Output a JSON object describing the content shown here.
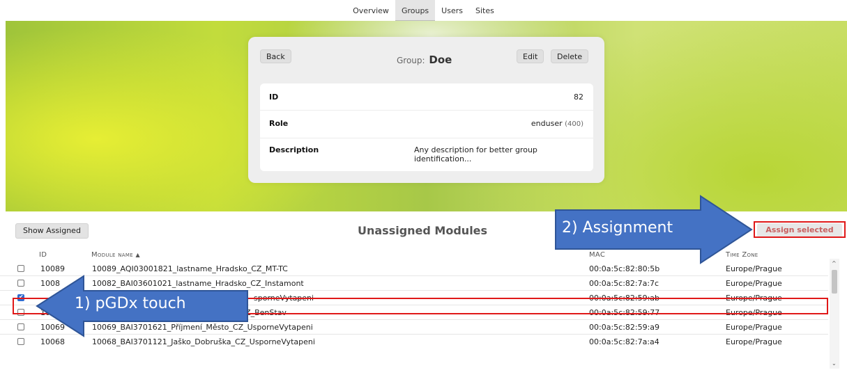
{
  "nav": {
    "tabs": [
      {
        "label": "Overview"
      },
      {
        "label": "Groups"
      },
      {
        "label": "Users"
      },
      {
        "label": "Sites"
      }
    ]
  },
  "card": {
    "back_label": "Back",
    "group_prefix": "Group:",
    "group_name": "Doe",
    "edit_label": "Edit",
    "delete_label": "Delete",
    "fields": {
      "id_key": "ID",
      "id_value": "82",
      "role_key": "Role",
      "role_value": "enduser",
      "role_code": "(400)",
      "desc_key": "Description",
      "desc_value_line1": "Any description for better group",
      "desc_value_line2": "identification..."
    }
  },
  "lower": {
    "show_assigned_label": "Show Assigned",
    "title": "Unassigned Modules",
    "assign_selected_label": "Assign selected",
    "columns": {
      "id": "ID",
      "module_name": "Module name",
      "sort_indicator": "▲",
      "mac": "MAC",
      "timezone": "Time Zone"
    },
    "rows": [
      {
        "id": "10089",
        "name": "10089_AQI03001821_lastname_Hradsko_CZ_MT-TC",
        "mac": "00:0a:5c:82:80:5b",
        "tz": "Europe/Prague"
      },
      {
        "id": "1008",
        "name": "10082_BAI03601021_lastname_Hradsko_CZ_Instamont",
        "mac": "00:0a:5c:82:7a:7c",
        "tz": "Europe/Prague"
      },
      {
        "id": "",
        "name": "sporneVytapeni",
        "mac": "00:0a:5c:82:59:ab",
        "tz": "Europe/Prague"
      },
      {
        "id": "1007",
        "name": "10070_BAI04301121_Jakoubek_Decin_CZ_BenStav",
        "mac": "00:0a:5c:82:59:77",
        "tz": "Europe/Prague"
      },
      {
        "id": "10069",
        "name": "10069_BAI3701621_Příjmení_Město_CZ_UsporneVytapeni",
        "mac": "00:0a:5c:82:59:a9",
        "tz": "Europe/Prague"
      },
      {
        "id": "10068",
        "name": "10068_BAI3701121_Jaško_Dobruška_CZ_UsporneVytapeni",
        "mac": "00:0a:5c:82:7a:a4",
        "tz": "Europe/Prague"
      }
    ]
  },
  "annotations": {
    "assignment_label": "2) Assignment",
    "touch_label": "1) pGDx touch",
    "arrow_color": "#4472c4",
    "highlight_color": "#e01818"
  }
}
